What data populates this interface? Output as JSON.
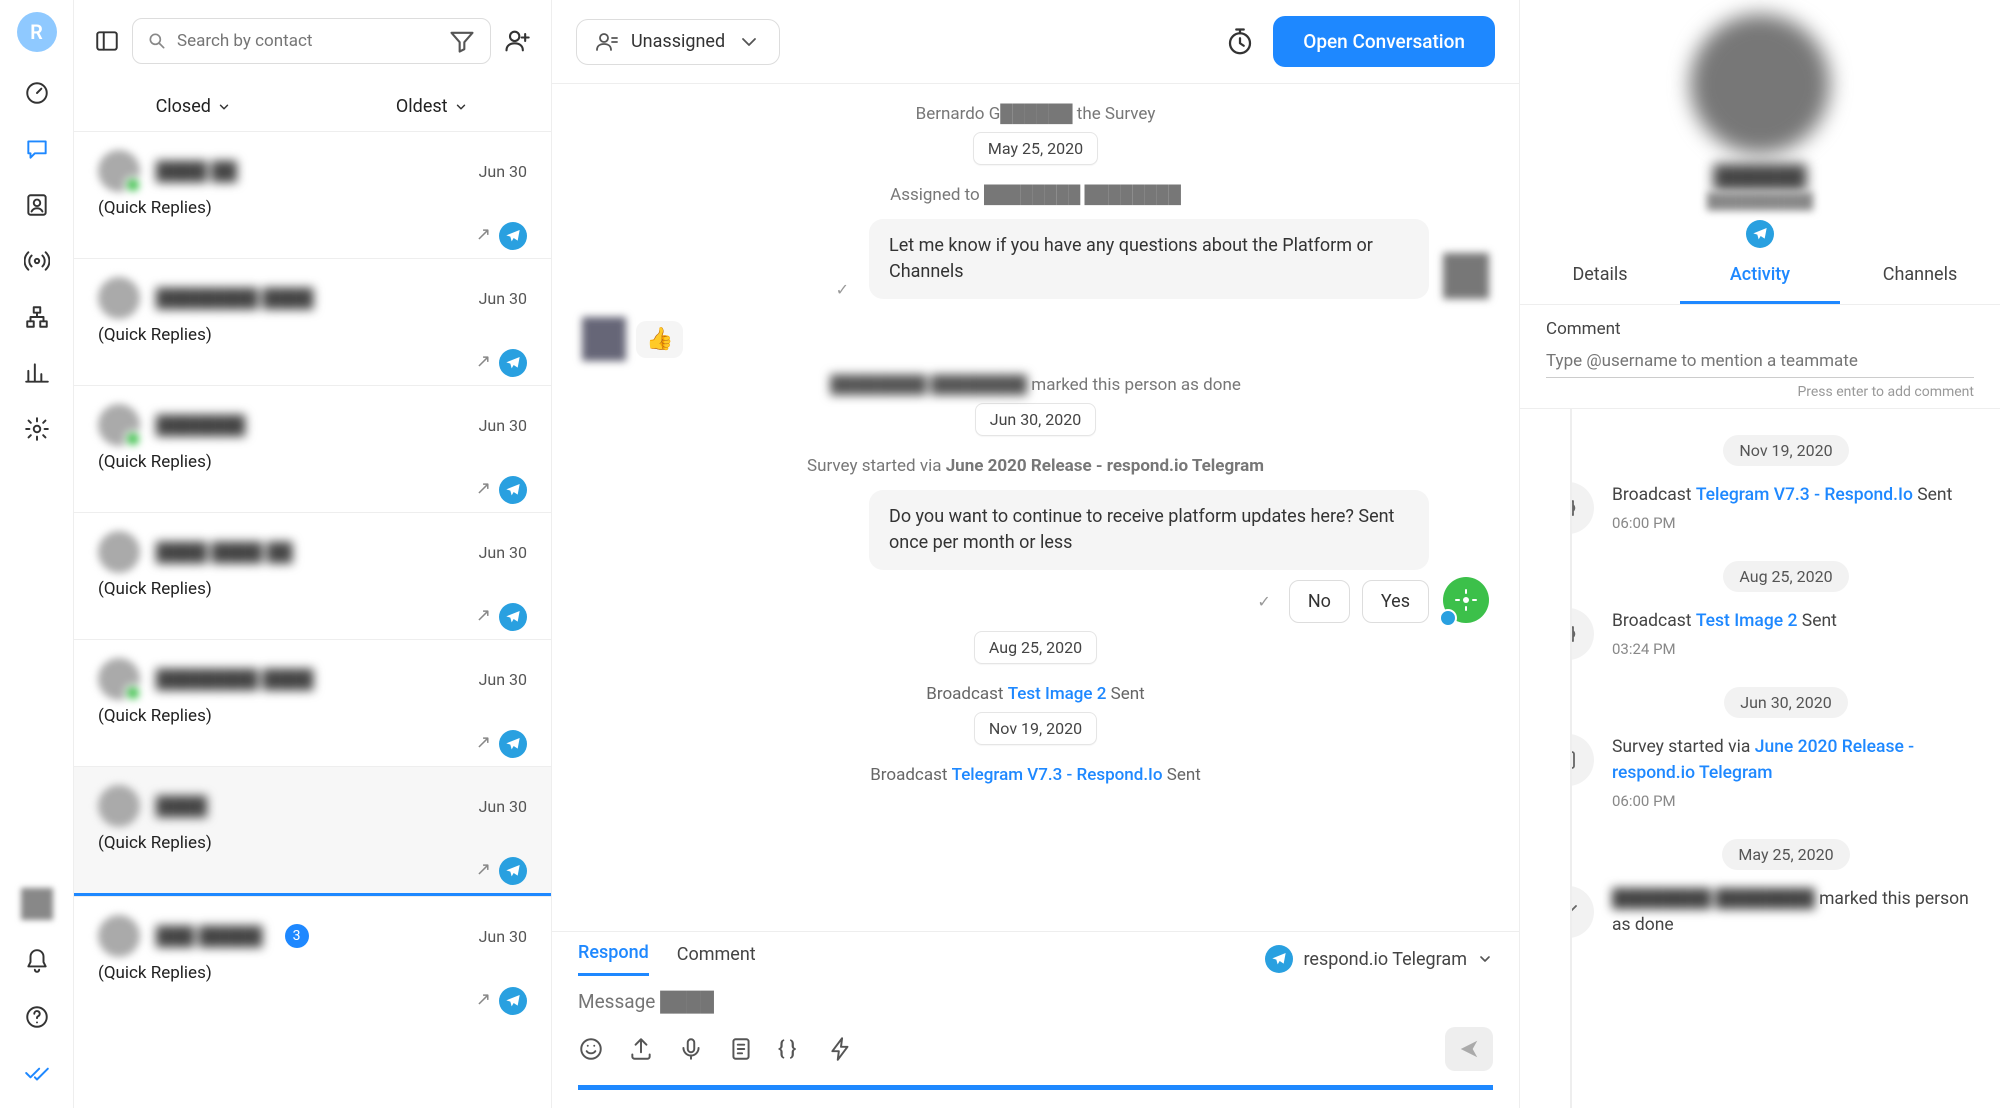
{
  "rail": {
    "avatar_letter": "R"
  },
  "contacts": {
    "search_placeholder": "Search by contact",
    "filter_closed": "Closed",
    "filter_sort": "Oldest",
    "items": [
      {
        "name": "████ ██",
        "date": "Jun 30",
        "sub": "(Quick Replies)",
        "presence": true
      },
      {
        "name": "████████ ████",
        "date": "Jun 30",
        "sub": "(Quick Replies)",
        "presence": false
      },
      {
        "name": "███████",
        "date": "Jun 30",
        "sub": "(Quick Replies)",
        "presence": true
      },
      {
        "name": "████ ████ ██",
        "date": "Jun 30",
        "sub": "(Quick Replies)",
        "presence": false
      },
      {
        "name": "████████ ████",
        "date": "Jun 30",
        "sub": "(Quick Replies)",
        "presence": true
      },
      {
        "name": "████",
        "date": "Jun 30",
        "sub": "(Quick Replies)",
        "presence": false,
        "selected": true
      },
      {
        "name": "███ █████",
        "date": "Jun 30",
        "sub": "(Quick Replies)",
        "presence": false,
        "count": "3"
      }
    ]
  },
  "conversation": {
    "assignee_label": "Unassigned",
    "open_button": "Open Conversation",
    "events": {
      "survey_top": "Bernardo G██████ the Survey",
      "date_may": "May 25, 2020",
      "assigned_to": "Assigned to ████████ ████████",
      "bubble1": "Let me know if you have any questions about the Platform or Channels",
      "marked_done": "████████ ████████ marked this person as done",
      "date_jun30": "Jun 30, 2020",
      "survey_started": "Survey started via",
      "survey_name": "June 2020 Release - respond.io Telegram",
      "bubble2": "Do you want to continue to receive platform updates here? Sent once per month or less",
      "btn_no": "No",
      "btn_yes": "Yes",
      "date_aug25": "Aug 25, 2020",
      "bc1_pre": "Broadcast",
      "bc1_link": "Test Image 2",
      "bc1_suf": "Sent",
      "date_nov19": "Nov 19, 2020",
      "bc2_pre": "Broadcast",
      "bc2_link": "Telegram V7.3 - Respond.Io",
      "bc2_suf": "Sent",
      "reaction": "👍"
    },
    "composer": {
      "tab_respond": "Respond",
      "tab_comment": "Comment",
      "channel": "respond.io Telegram",
      "placeholder": "Message ████"
    }
  },
  "sidebar": {
    "profile_name": "██████",
    "profile_sub": "██████████",
    "tabs": {
      "details": "Details",
      "activity": "Activity",
      "channels": "Channels"
    },
    "comment": {
      "label": "Comment",
      "placeholder": "Type @username to mention a teammate",
      "hint": "Press enter to add comment"
    },
    "feed": {
      "d_nov19": "Nov 19, 2020",
      "i1_pre": "Broadcast",
      "i1_link": "Telegram V7.3 - Respond.Io",
      "i1_suf": "Sent",
      "i1_time": "06:00 PM",
      "d_aug25": "Aug 25, 2020",
      "i2_pre": "Broadcast",
      "i2_link": "Test Image 2",
      "i2_suf": "Sent",
      "i2_time": "03:24 PM",
      "d_jun30": "Jun 30, 2020",
      "i3_pre": "Survey started via",
      "i3_link": "June 2020 Release - respond.io Telegram",
      "i3_time": "06:00 PM",
      "d_may25": "May 25, 2020",
      "i4_blur": "████████ ████████",
      "i4_text": "marked this person as done"
    }
  }
}
